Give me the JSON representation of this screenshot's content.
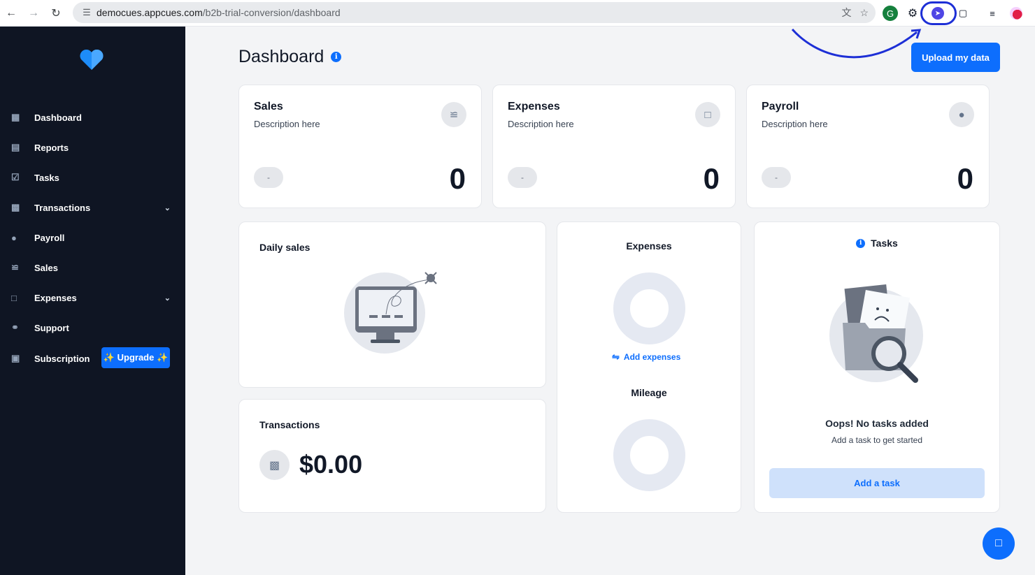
{
  "browser": {
    "url_domain": "democues.appcues.com",
    "url_path": "/b2b-trial-conversion/dashboard"
  },
  "sidebar": {
    "items": [
      {
        "label": "Dashboard",
        "icon": "grid-icon"
      },
      {
        "label": "Reports",
        "icon": "document-icon"
      },
      {
        "label": "Tasks",
        "icon": "tasks-icon"
      },
      {
        "label": "Transactions",
        "icon": "wallet-icon",
        "expandable": true
      },
      {
        "label": "Payroll",
        "icon": "money-bag-icon"
      },
      {
        "label": "Sales",
        "icon": "chart-icon"
      },
      {
        "label": "Expenses",
        "icon": "expenses-icon",
        "expandable": true
      },
      {
        "label": "Support",
        "icon": "headset-icon"
      },
      {
        "label": "Subscription",
        "icon": "subscription-icon"
      }
    ],
    "upgrade_label": "✨ Upgrade ✨"
  },
  "header": {
    "title": "Dashboard",
    "upload_label": "Upload my data"
  },
  "stats": [
    {
      "title": "Sales",
      "desc": "Description here",
      "pill": "-",
      "value": "0"
    },
    {
      "title": "Expenses",
      "desc": "Description here",
      "pill": "-",
      "value": "0"
    },
    {
      "title": "Payroll",
      "desc": "Description here",
      "pill": "-",
      "value": "0"
    }
  ],
  "daily_sales": {
    "title": "Daily sales"
  },
  "transactions": {
    "title": "Transactions",
    "value": "$0.00"
  },
  "expenses_panel": {
    "title": "Expenses",
    "add_label": "Add expenses",
    "mileage_title": "Mileage"
  },
  "tasks": {
    "title": "Tasks",
    "empty_title": "Oops! No tasks added",
    "empty_sub": "Add a task to get started",
    "add_label": "Add a task"
  },
  "colors": {
    "sidebar_bg": "#0f1523",
    "accent": "#0d6efd",
    "page_bg": "#f3f4f6"
  }
}
